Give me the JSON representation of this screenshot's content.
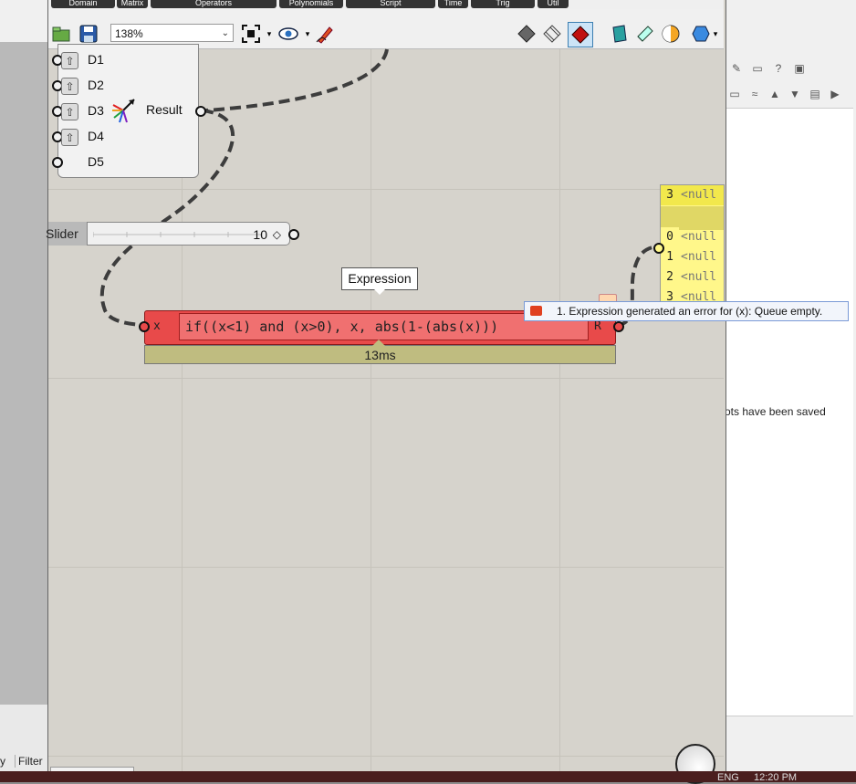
{
  "ribbon": {
    "tabs": [
      "Domain",
      "Matrix",
      "Operators",
      "Polynomials",
      "Script",
      "Time",
      "Trig",
      "Util"
    ]
  },
  "toolbar": {
    "zoom": "138%",
    "icons": [
      "open-file-icon",
      "save-icon",
      "zoom-extents-icon",
      "preview-eye-icon",
      "sketch-pen-icon",
      "preview-shaded-icon",
      "preview-wireframe-icon",
      "preview-selected-icon",
      "document-icon",
      "bake-icon",
      "sphere-icon",
      "shape-icon"
    ]
  },
  "graph_mapper": {
    "inputs": [
      "D1",
      "D2",
      "D3",
      "D4",
      "D5"
    ],
    "output": "Result"
  },
  "slider": {
    "name": "Slider",
    "value": "10"
  },
  "expression": {
    "label": "Expression",
    "input": "x",
    "output": "R",
    "formula": "if((x<1) and (x>0), x, abs(1-(abs(x)))",
    "time": "13ms"
  },
  "panel": {
    "header_index": "3",
    "header_value": "<null",
    "rows": [
      {
        "index": "0",
        "value": "<null"
      },
      {
        "index": "1",
        "value": "<null"
      },
      {
        "index": "2",
        "value": "<null"
      },
      {
        "index": "3",
        "value": "<null"
      }
    ]
  },
  "error": {
    "message": "1. Expression generated an error for (x): Queue empty."
  },
  "right_panel": {
    "status": "ots have been saved"
  },
  "left_panel": {
    "tab_partial": "y",
    "filter": "Filter"
  },
  "taskbar": {
    "lang": "ENG",
    "time": "12:20 PM"
  },
  "colors": {
    "error_red": "#e84a4a",
    "panel_yellow": "#fff78a",
    "canvas": "#d6d3cc"
  }
}
